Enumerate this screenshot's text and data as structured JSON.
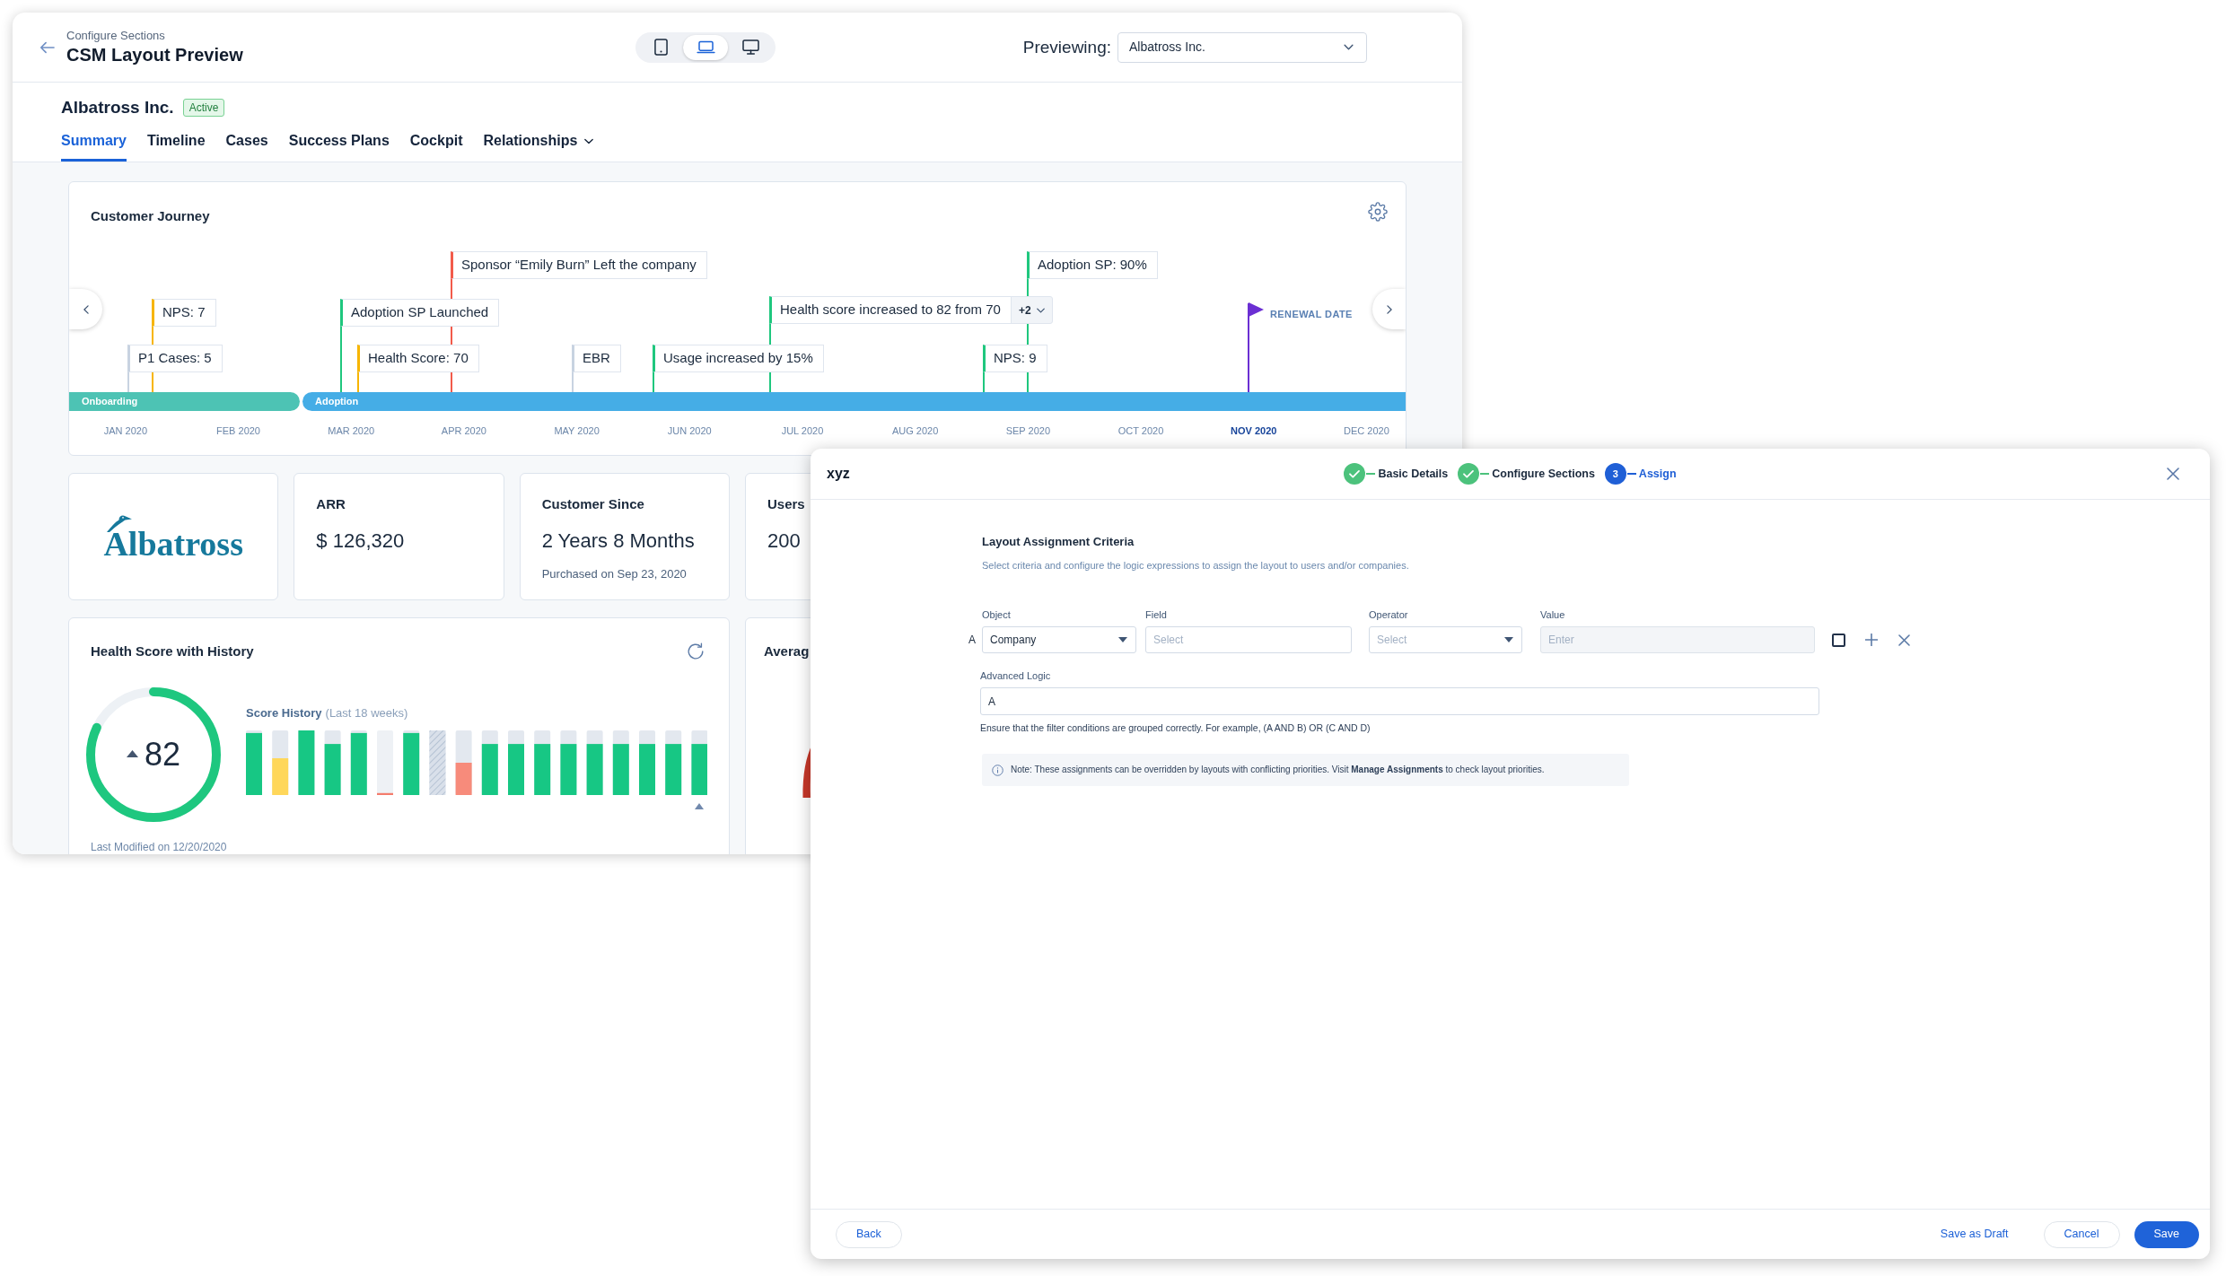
{
  "preview_window": {
    "breadcrumb": "Configure Sections",
    "title": "CSM Layout Preview",
    "device_toggles": [
      {
        "kind": "tablet",
        "selected": false
      },
      {
        "kind": "laptop",
        "selected": true
      },
      {
        "kind": "desktop",
        "selected": false
      }
    ],
    "previewing": {
      "label": "Previewing:",
      "value": "Albatross Inc."
    },
    "company": {
      "name": "Albatross Inc.",
      "status": "Active"
    },
    "tabs": [
      {
        "label": "Summary",
        "selected": true
      },
      {
        "label": "Timeline",
        "selected": false
      },
      {
        "label": "Cases",
        "selected": false
      },
      {
        "label": "Success Plans",
        "selected": false
      },
      {
        "label": "Cockpit",
        "selected": false
      },
      {
        "label": "Relationships",
        "selected": false,
        "dropdown": true
      }
    ],
    "customer_journey": {
      "title": "Customer Journey",
      "events": [
        {
          "label": "P1 Cases: 5",
          "color": "#c8d3e1"
        },
        {
          "label": "NPS: 7",
          "color": "#f7b500"
        },
        {
          "label": "Adoption SP Launched",
          "color": "#1fc77e"
        },
        {
          "label": "Health Score: 70",
          "color": "#f7b500"
        },
        {
          "label": "Sponsor “Emily Burn” Left the company",
          "color": "#f25b4b"
        },
        {
          "label": "EBR",
          "color": "#c8d3e1"
        },
        {
          "label": "Usage increased by 15%",
          "color": "#1fc77e"
        },
        {
          "label": "Health score increased to 82 from 70",
          "color": "#1fc77e",
          "more": "+2"
        },
        {
          "label": "NPS: 9",
          "color": "#1fc77e"
        },
        {
          "label": "Adoption SP: 90%",
          "color": "#1fc77e"
        }
      ],
      "renewal_label": "RENEWAL DATE",
      "phases": [
        {
          "label": "Onboarding",
          "color": "#4dc3b4"
        },
        {
          "label": "Adoption",
          "color": "#45ade6"
        }
      ],
      "months": [
        {
          "label": "JAN 2020",
          "current": false
        },
        {
          "label": "FEB 2020",
          "current": false
        },
        {
          "label": "MAR 2020",
          "current": false
        },
        {
          "label": "APR 2020",
          "current": false
        },
        {
          "label": "MAY 2020",
          "current": false
        },
        {
          "label": "JUN 2020",
          "current": false
        },
        {
          "label": "JUL 2020",
          "current": false
        },
        {
          "label": "AUG 2020",
          "current": false
        },
        {
          "label": "SEP 2020",
          "current": false
        },
        {
          "label": "OCT 2020",
          "current": false
        },
        {
          "label": "NOV 2020",
          "current": true
        },
        {
          "label": "DEC 2020",
          "current": false
        }
      ]
    },
    "stat_cards": [
      {
        "kind": "logo",
        "logo_text": "Albatross"
      },
      {
        "kind": "stat",
        "label": "ARR",
        "value": "$ 126,320"
      },
      {
        "kind": "stat",
        "label": "Customer Since",
        "value": "2 Years 8 Months",
        "note": "Purchased on Sep 23, 2020"
      },
      {
        "kind": "stat",
        "label": "Users",
        "value": "200"
      }
    ],
    "health_score": {
      "title": "Health Score with History",
      "score": "82",
      "level": 0.82,
      "history_title": "Score History",
      "history_period": "(Last 18 weeks)",
      "last_modified": "Last Modified on 12/20/2020"
    },
    "average_card": {
      "title": "Averag"
    }
  },
  "assignment_modal": {
    "title": "xyz",
    "steps": [
      {
        "label": "Basic Details",
        "done": true,
        "current": false
      },
      {
        "label": "Configure Sections",
        "done": true,
        "current": false
      },
      {
        "label": "Assign",
        "number": "3",
        "done": false,
        "current": true
      }
    ],
    "section_title": "Layout Assignment Criteria",
    "description": "Select criteria and configure the logic expressions to assign the layout to users and/or companies.",
    "columns": [
      "Object",
      "Field",
      "Operator",
      "Value"
    ],
    "criteria_rows": [
      {
        "letter": "A",
        "cells": [
          {
            "kind": "select",
            "value": "Company"
          },
          {
            "kind": "input",
            "placeholder": "Select"
          },
          {
            "kind": "select",
            "placeholder": "Select"
          },
          {
            "kind": "input",
            "placeholder": "Enter",
            "disabled": true
          }
        ],
        "checked": false
      }
    ],
    "advanced_logic": {
      "label": "Advanced Logic",
      "value": "A",
      "hint": "Ensure that the filter conditions are grouped correctly. For example, (A AND B) OR (C AND D)"
    },
    "note": "Note: These assignments can be overridden by layouts with conflicting priorities. Visit **Manage Assignments** to check layout priorities.",
    "footer": {
      "left": [
        {
          "label": "Back",
          "kind": "outline"
        }
      ],
      "right": [
        {
          "label": "Save as Draft",
          "kind": "link"
        },
        {
          "label": "Cancel",
          "kind": "outline"
        },
        {
          "label": "Save",
          "kind": "primary"
        }
      ]
    }
  }
}
